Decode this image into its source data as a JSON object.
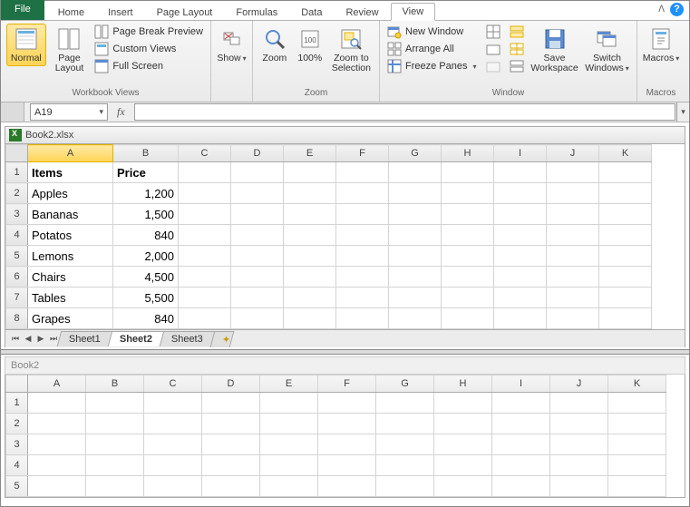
{
  "tabs": {
    "file": "File",
    "items": [
      "Home",
      "Insert",
      "Page Layout",
      "Formulas",
      "Data",
      "Review",
      "View"
    ],
    "active": "View"
  },
  "ribbon": {
    "workbook_views": {
      "label": "Workbook Views",
      "normal": "Normal",
      "page_layout": "Page\nLayout",
      "page_break": "Page Break Preview",
      "custom": "Custom Views",
      "full_screen": "Full Screen"
    },
    "show": {
      "label": "",
      "show": "Show"
    },
    "zoom": {
      "label": "Zoom",
      "zoom": "Zoom",
      "hundred": "100%",
      "to_sel": "Zoom to\nSelection"
    },
    "window": {
      "label": "Window",
      "new_window": "New Window",
      "arrange_all": "Arrange All",
      "freeze": "Freeze Panes",
      "save_ws": "Save\nWorkspace",
      "switch": "Switch\nWindows"
    },
    "macros": {
      "label": "Macros",
      "macros": "Macros"
    }
  },
  "name_box": "A19",
  "fx": "fx",
  "workbook1": {
    "title": "Book2.xlsx",
    "columns": [
      "A",
      "B",
      "C",
      "D",
      "E",
      "F",
      "G",
      "H",
      "I",
      "J",
      "K"
    ],
    "active_col": "A",
    "rows": [
      {
        "n": "1",
        "a": "Items",
        "b": "Price",
        "bold": true
      },
      {
        "n": "2",
        "a": "Apples",
        "b": "1,200"
      },
      {
        "n": "3",
        "a": "Bananas",
        "b": "1,500"
      },
      {
        "n": "4",
        "a": "Potatos",
        "b": "840"
      },
      {
        "n": "5",
        "a": "Lemons",
        "b": "2,000"
      },
      {
        "n": "6",
        "a": "Chairs",
        "b": "4,500"
      },
      {
        "n": "7",
        "a": "Tables",
        "b": "5,500"
      },
      {
        "n": "8",
        "a": "Grapes",
        "b": "840"
      }
    ],
    "sheets": [
      "Sheet1",
      "Sheet2",
      "Sheet3"
    ],
    "active_sheet": "Sheet2"
  },
  "workbook2": {
    "title": "Book2",
    "columns": [
      "A",
      "B",
      "C",
      "D",
      "E",
      "F",
      "G",
      "H",
      "I",
      "J",
      "K"
    ],
    "rows": [
      "1",
      "2",
      "3",
      "4",
      "5"
    ]
  },
  "chart_data": {
    "type": "table",
    "title": "Items / Price",
    "columns": [
      "Items",
      "Price"
    ],
    "rows": [
      [
        "Apples",
        1200
      ],
      [
        "Bananas",
        1500
      ],
      [
        "Potatos",
        840
      ],
      [
        "Lemons",
        2000
      ],
      [
        "Chairs",
        4500
      ],
      [
        "Tables",
        5500
      ],
      [
        "Grapes",
        840
      ]
    ]
  }
}
